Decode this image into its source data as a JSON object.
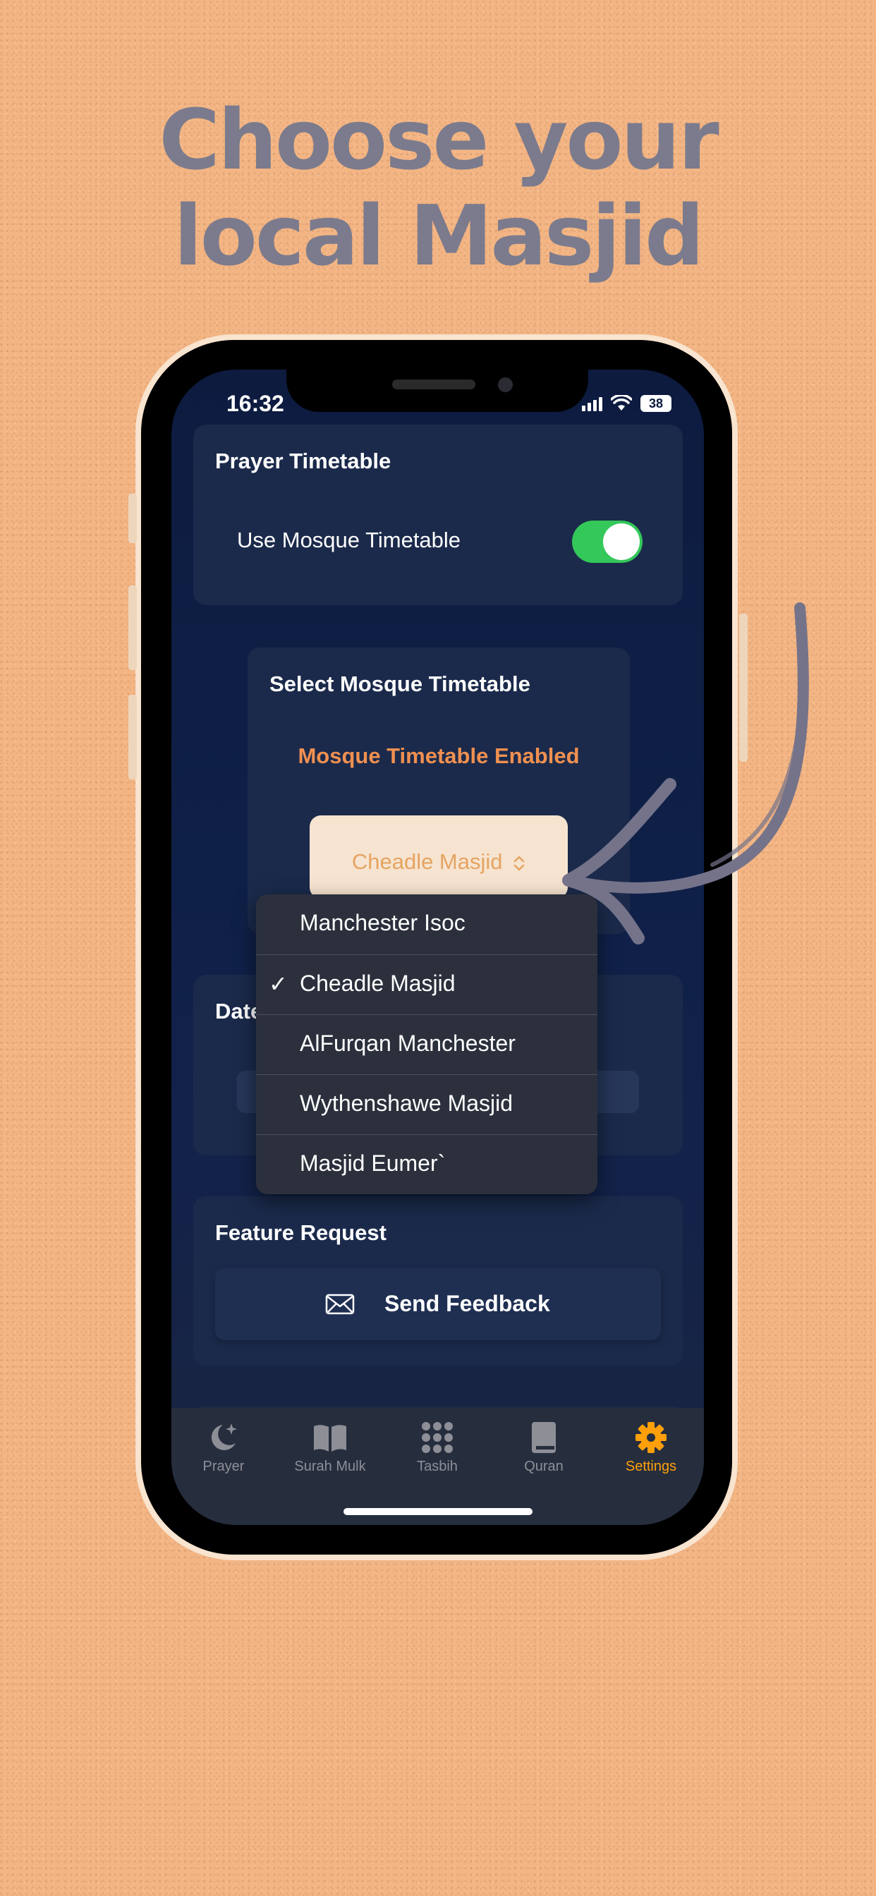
{
  "headline": {
    "line1": "Choose your",
    "line2": "local Masjid"
  },
  "status_bar": {
    "time": "16:32",
    "battery": "38"
  },
  "prayer_card": {
    "title": "Prayer Timetable",
    "toggle_label": "Use Mosque Timetable",
    "toggle_on": true
  },
  "mosque_card": {
    "title": "Select Mosque Timetable",
    "status": "Mosque Timetable Enabled",
    "selected": "Cheadle Masjid",
    "picker_chevron": "⌃⌄"
  },
  "dropdown": {
    "options": [
      {
        "label": "Manchester Isoc",
        "checked": false
      },
      {
        "label": "Cheadle Masjid",
        "checked": true
      },
      {
        "label": "AlFurqan Manchester",
        "checked": false
      },
      {
        "label": "Wythenshawe Masjid",
        "checked": false
      },
      {
        "label": "Masjid Eumer`",
        "checked": false
      }
    ],
    "check_glyph": "✓"
  },
  "date_card": {
    "title_partial": "Date"
  },
  "feature_card": {
    "title": "Feature Request",
    "button_label": "Send Feedback",
    "button_icon": "envelope-icon"
  },
  "tabbar": {
    "tabs": [
      {
        "label": "Prayer",
        "icon": "moon-stars-icon"
      },
      {
        "label": "Surah Mulk",
        "icon": "book-open-icon"
      },
      {
        "label": "Tasbih",
        "icon": "grid-dots-icon"
      },
      {
        "label": "Quran",
        "icon": "book-closed-icon"
      },
      {
        "label": "Settings",
        "icon": "gear-icon",
        "active": true
      }
    ]
  },
  "colors": {
    "background": "#f3b584",
    "headline": "#7b7b8d",
    "accent_orange": "#f09050",
    "toggle_green": "#34c759",
    "active_tab": "#ffa00a"
  }
}
